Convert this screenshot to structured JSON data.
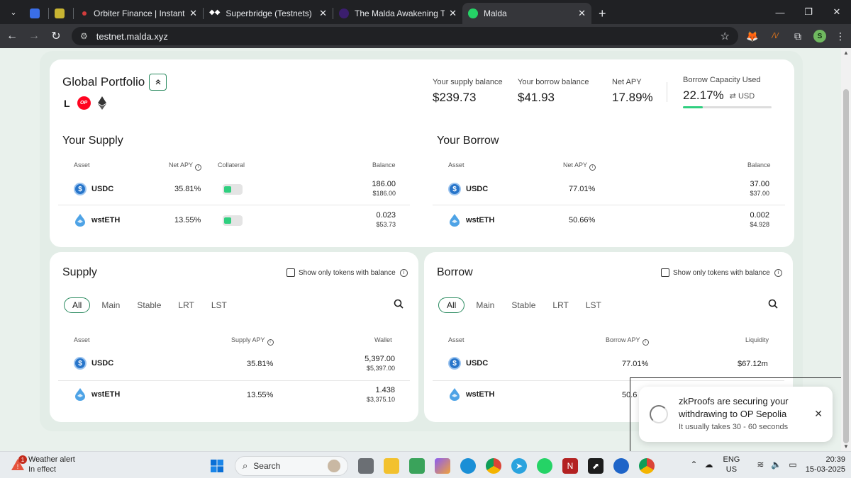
{
  "browser": {
    "tabs": [
      {
        "title": "",
        "active": false,
        "color": "#3a6ee8"
      },
      {
        "title": "",
        "active": false,
        "color": "#c8b432"
      },
      {
        "title": "Orbiter Finance | Instantly Bridge",
        "active": false,
        "color": "#d23c3c"
      },
      {
        "title": "Superbridge (Testnets)",
        "active": false,
        "color": "#ffffff"
      },
      {
        "title": "The Malda Awakening Testnet C",
        "active": false,
        "color": "#7b3fe4"
      },
      {
        "title": "Malda",
        "active": true,
        "color": "#25d366"
      }
    ],
    "url": "testnet.malda.xyz",
    "profile_initial": "S"
  },
  "portfolio": {
    "title": "Global Portfolio",
    "chain_l": "L",
    "chain_op": "OP",
    "supply_balance_label": "Your supply balance",
    "supply_balance": "$239.73",
    "borrow_balance_label": "Your borrow balance",
    "borrow_balance": "$41.93",
    "net_apy_label": "Net APY",
    "net_apy": "17.89%",
    "capacity_label": "Borrow Capacity Used",
    "capacity_value": "22.17%",
    "capacity_unit": "USD",
    "capacity_fraction": 0.2217
  },
  "your_supply": {
    "title": "Your Supply",
    "headers": {
      "asset": "Asset",
      "apy": "Net APY",
      "collateral": "Collateral",
      "balance": "Balance"
    },
    "rows": [
      {
        "asset": "USDC",
        "apy": "35.81%",
        "balance": "186.00",
        "balance_usd": "$186.00",
        "collateral": true
      },
      {
        "asset": "wstETH",
        "apy": "13.55%",
        "balance": "0.023",
        "balance_usd": "$53.73",
        "collateral": true
      }
    ]
  },
  "your_borrow": {
    "title": "Your Borrow",
    "headers": {
      "asset": "Asset",
      "apy": "Net APY",
      "balance": "Balance"
    },
    "rows": [
      {
        "asset": "USDC",
        "apy": "77.01%",
        "balance": "37.00",
        "balance_usd": "$37.00"
      },
      {
        "asset": "wstETH",
        "apy": "50.66%",
        "balance": "0.002",
        "balance_usd": "$4.928"
      }
    ]
  },
  "supply_market": {
    "title": "Supply",
    "checkbox_label": "Show only tokens with balance",
    "filters": [
      "All",
      "Main",
      "Stable",
      "LRT",
      "LST"
    ],
    "headers": {
      "asset": "Asset",
      "apy": "Supply APY",
      "wallet": "Wallet"
    },
    "rows": [
      {
        "asset": "USDC",
        "apy": "35.81%",
        "wallet": "5,397.00",
        "wallet_usd": "$5,397.00"
      },
      {
        "asset": "wstETH",
        "apy": "13.55%",
        "wallet": "1.438",
        "wallet_usd": "$3,375.10"
      }
    ]
  },
  "borrow_market": {
    "title": "Borrow",
    "checkbox_label": "Show only tokens with balance",
    "filters": [
      "All",
      "Main",
      "Stable",
      "LRT",
      "LST"
    ],
    "headers": {
      "asset": "Asset",
      "apy": "Borrow APY",
      "liquidity": "Liquidity"
    },
    "rows": [
      {
        "asset": "USDC",
        "apy": "77.01%",
        "liquidity": "$67.12m"
      },
      {
        "asset": "wstETH",
        "apy": "50.6"
      }
    ]
  },
  "toast": {
    "title": "zkProofs are securing your withdrawing to OP Sepolia",
    "subtitle": "It usually takes 30 - 60 seconds"
  },
  "taskbar": {
    "weather_title": "Weather alert",
    "weather_sub": "In effect",
    "weather_badge": "1",
    "search_label": "Search",
    "lang_top": "ENG",
    "lang_bottom": "US",
    "time": "20:39",
    "date": "15-03-2025"
  },
  "colors": {
    "accent": "#2fcf7f",
    "accent_border": "#2a8a5f",
    "usdc": "#2775ca",
    "op": "#ff0420"
  }
}
